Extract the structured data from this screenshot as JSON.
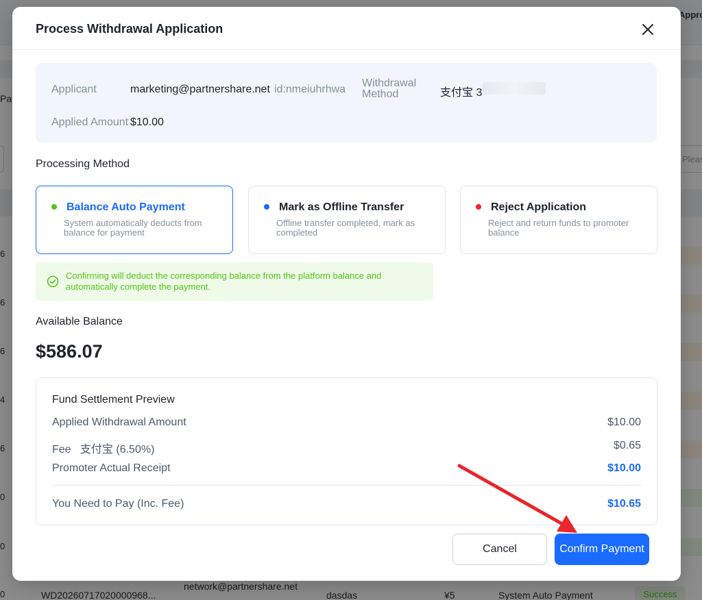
{
  "modal": {
    "title": "Process Withdrawal Application"
  },
  "applicant": {
    "label": "Applicant",
    "email": "marketing@partnershare.net",
    "id": "id:nmeiuhrhwa",
    "method_label": "Withdrawal Method",
    "method_value": "支付宝 3",
    "amount_label": "Applied Amount",
    "amount_value": "$10.00"
  },
  "processing": {
    "title": "Processing Method",
    "options": [
      {
        "title": "Balance Auto Payment",
        "desc": "System automatically deducts from balance for payment",
        "dot_color": "#52c41a",
        "selected": true
      },
      {
        "title": "Mark as Offline Transfer",
        "desc": "Offline transfer completed, mark as completed",
        "dot_color": "#1a6bff",
        "selected": false
      },
      {
        "title": "Reject Application",
        "desc": "Reject and return funds to promoter balance",
        "dot_color": "#f5222d",
        "selected": false
      }
    ],
    "notice": "Confirming will deduct the corresponding balance from the platform balance and automatically complete the payment."
  },
  "balance": {
    "label": "Available Balance",
    "amount": "$586.07"
  },
  "settlement": {
    "title": "Fund Settlement Preview",
    "rows": [
      {
        "label": "Applied Withdrawal Amount",
        "value": "$10.00"
      },
      {
        "label": "Fee",
        "sub": "支付宝 (6.50%)",
        "value": "$0.65"
      },
      {
        "label": "Promoter Actual Receipt",
        "value": "$10.00"
      }
    ],
    "total_label": "You Need to Pay (Inc. Fee)",
    "total_value": "$10.65"
  },
  "buttons": {
    "cancel": "Cancel",
    "confirm": "Confirm Payment"
  },
  "background": {
    "approx_header": "Approx",
    "search_placeholder": "Please se",
    "left_pay": "Pay",
    "row": {
      "id": "WD20260717020000968...",
      "email": "network@partnershare.net",
      "note": "dasdas",
      "amount": "¥5",
      "method": "System Auto Payment",
      "status": "Success"
    },
    "left_nums": [
      "6",
      "6",
      "6",
      "4",
      "6",
      "0",
      "0",
      "0"
    ]
  },
  "colors": {
    "primary": "#1a6bff",
    "success": "#52c41a",
    "danger": "#f5222d",
    "annotation_arrow": "#e8262b"
  }
}
